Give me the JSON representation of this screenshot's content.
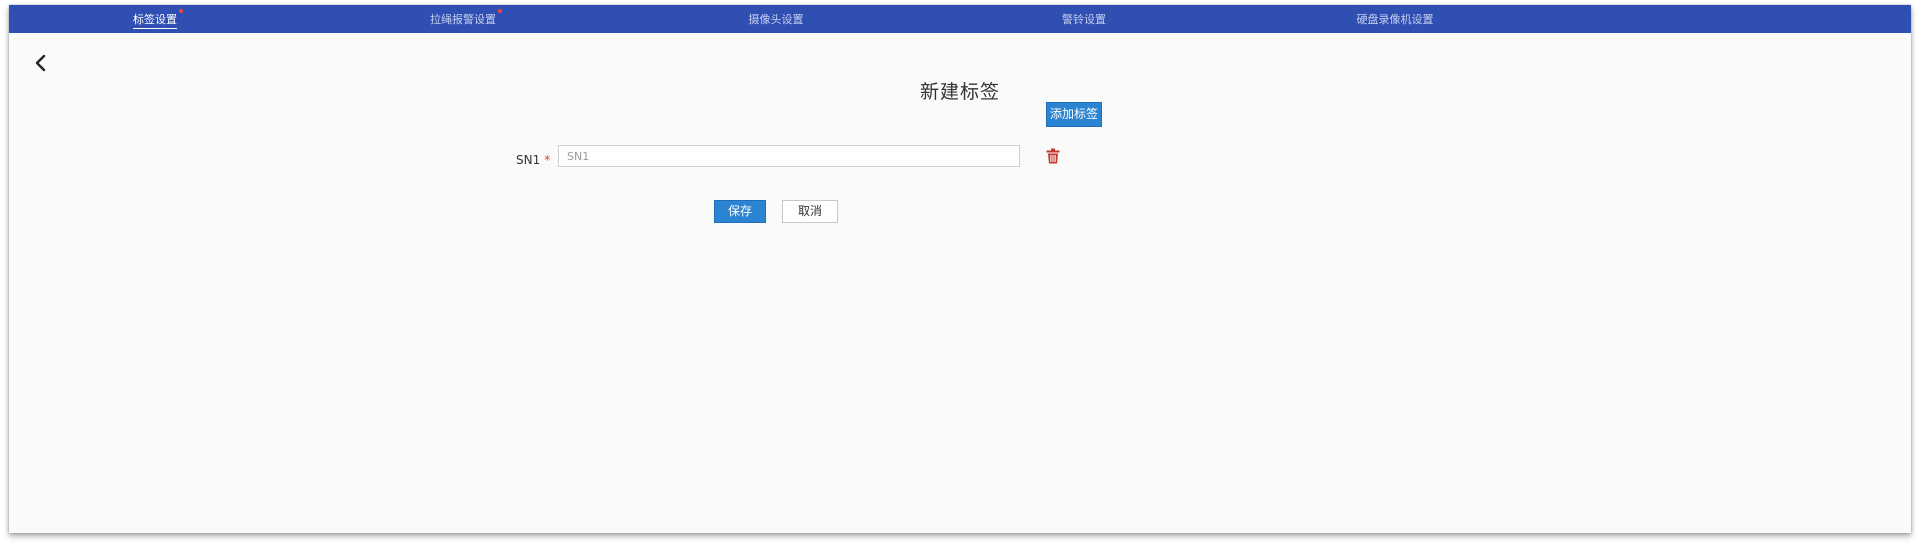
{
  "nav": {
    "items": [
      {
        "label": "标签设置",
        "active": true,
        "alert": true
      },
      {
        "label": "拉绳报警设置",
        "active": false,
        "alert": true
      },
      {
        "label": "摄像头设置",
        "active": false,
        "alert": false
      },
      {
        "label": "警铃设置",
        "active": false,
        "alert": false
      },
      {
        "label": "硬盘录像机设置",
        "active": false,
        "alert": false
      }
    ]
  },
  "page": {
    "title": "新建标签",
    "back_icon": "chevron-left-icon"
  },
  "toolbar": {
    "add_label": "添加标签"
  },
  "form": {
    "fields": [
      {
        "label": "SN1",
        "required_mark": "*",
        "value": "",
        "placeholder": "SN1",
        "delete_icon": "trash-icon"
      }
    ],
    "save_label": "保存",
    "cancel_label": "取消"
  },
  "colors": {
    "nav_bg": "#2f4fb3",
    "primary": "#2b84d1",
    "danger": "#c0392b",
    "required": "#e23b3b"
  }
}
